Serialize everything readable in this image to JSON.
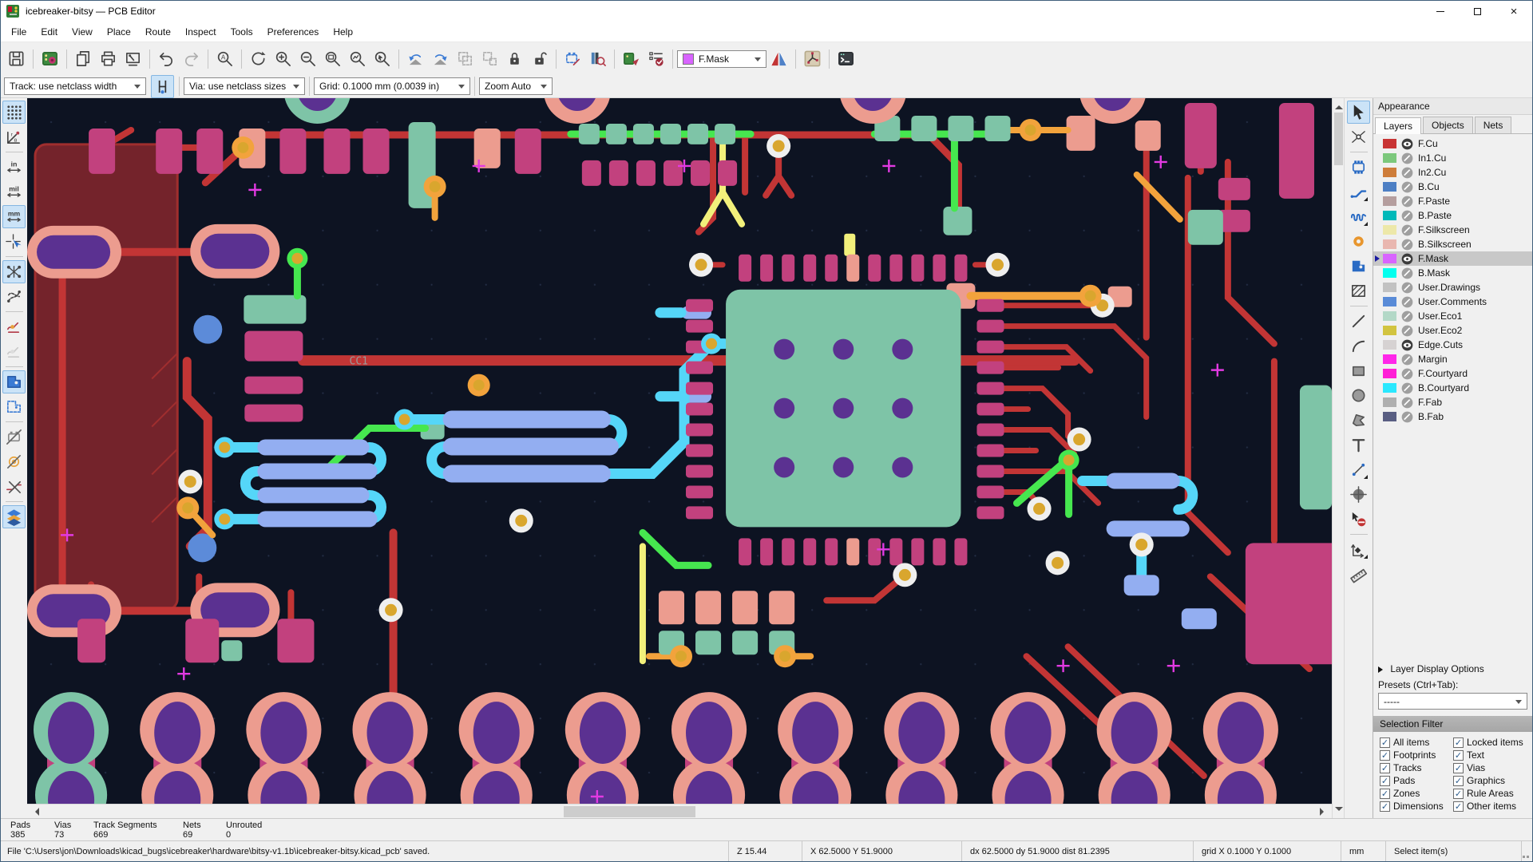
{
  "window": {
    "title": "icebreaker-bitsy — PCB Editor"
  },
  "menu": {
    "items": [
      "File",
      "Edit",
      "View",
      "Place",
      "Route",
      "Inspect",
      "Tools",
      "Preferences",
      "Help"
    ]
  },
  "toolbar": {
    "layer_select": "F.Mask",
    "layer_swatch": "#D864FF",
    "track_select": "Track: use netclass width",
    "via_select": "Via: use netclass sizes",
    "grid_select": "Grid: 0.1000 mm (0.0039 in)",
    "zoom_select": "Zoom Auto"
  },
  "appearance": {
    "title": "Appearance",
    "tabs": [
      "Layers",
      "Objects",
      "Nets"
    ],
    "active_tab": "Layers",
    "layers": [
      {
        "name": "F.Cu",
        "color": "#C83434",
        "visible": true,
        "selected": false
      },
      {
        "name": "In1.Cu",
        "color": "#7CC87C",
        "visible": false,
        "selected": false
      },
      {
        "name": "In2.Cu",
        "color": "#CE7D3A",
        "visible": false,
        "selected": false
      },
      {
        "name": "B.Cu",
        "color": "#4D7FC4",
        "visible": false,
        "selected": false
      },
      {
        "name": "F.Paste",
        "color": "#B59E9E",
        "visible": false,
        "selected": false
      },
      {
        "name": "B.Paste",
        "color": "#00B9B9",
        "visible": false,
        "selected": false
      },
      {
        "name": "F.Silkscreen",
        "color": "#EDE8A9",
        "visible": false,
        "selected": false
      },
      {
        "name": "B.Silkscreen",
        "color": "#E9B7B0",
        "visible": false,
        "selected": false
      },
      {
        "name": "F.Mask",
        "color": "#D864FF",
        "visible": true,
        "selected": true
      },
      {
        "name": "B.Mask",
        "color": "#02FFEE",
        "visible": false,
        "selected": false
      },
      {
        "name": "User.Drawings",
        "color": "#C2C2C2",
        "visible": false,
        "selected": false
      },
      {
        "name": "User.Comments",
        "color": "#598BD7",
        "visible": false,
        "selected": false
      },
      {
        "name": "User.Eco1",
        "color": "#B3D8C7",
        "visible": false,
        "selected": false
      },
      {
        "name": "User.Eco2",
        "color": "#D2C440",
        "visible": false,
        "selected": false
      },
      {
        "name": "Edge.Cuts",
        "color": "#D6D2D2",
        "visible": true,
        "selected": false
      },
      {
        "name": "Margin",
        "color": "#FF27E9",
        "visible": false,
        "selected": false
      },
      {
        "name": "F.Courtyard",
        "color": "#FF1FD6",
        "visible": false,
        "selected": false
      },
      {
        "name": "B.Courtyard",
        "color": "#2BE8FE",
        "visible": false,
        "selected": false
      },
      {
        "name": "F.Fab",
        "color": "#AFAFAF",
        "visible": false,
        "selected": false
      },
      {
        "name": "B.Fab",
        "color": "#595E82",
        "visible": false,
        "selected": false
      }
    ],
    "layer_display_options": "Layer Display Options",
    "presets_label": "Presets (Ctrl+Tab):",
    "presets_value": "-----"
  },
  "selection_filter": {
    "title": "Selection Filter",
    "items": [
      {
        "label": "All items",
        "checked": true
      },
      {
        "label": "Locked items",
        "checked": true
      },
      {
        "label": "Footprints",
        "checked": true
      },
      {
        "label": "Text",
        "checked": true
      },
      {
        "label": "Tracks",
        "checked": true
      },
      {
        "label": "Vias",
        "checked": true
      },
      {
        "label": "Pads",
        "checked": true
      },
      {
        "label": "Graphics",
        "checked": true
      },
      {
        "label": "Zones",
        "checked": true
      },
      {
        "label": "Rule Areas",
        "checked": true
      },
      {
        "label": "Dimensions",
        "checked": true
      },
      {
        "label": "Other items",
        "checked": true
      }
    ]
  },
  "status": {
    "counters": [
      {
        "label": "Pads",
        "value": "385"
      },
      {
        "label": "Vias",
        "value": "73"
      },
      {
        "label": "Track Segments",
        "value": "669"
      },
      {
        "label": "Nets",
        "value": "69"
      },
      {
        "label": "Unrouted",
        "value": "0"
      }
    ],
    "message": "File 'C:\\Users\\jon\\Downloads\\kicad_bugs\\icebreaker\\hardware\\bitsy-v1.1b\\icebreaker-bitsy.kicad_pcb' saved.",
    "zoom": "Z 15.44",
    "position": "X 62.5000  Y 51.9000",
    "delta": "dx 62.5000  dy 51.9000  dist 81.2395",
    "grid": "grid X 0.1000  Y 0.1000",
    "units": "mm",
    "action": "Select item(s)"
  },
  "canvas": {
    "labels": {
      "cc1": "CC1"
    },
    "colors": {
      "bg": "#0D1322",
      "zone": "#74232B",
      "zone_edge": "#A02E2E",
      "red": "#C23535",
      "magenta": "#C2417E",
      "salmon": "#EC9C8F",
      "seagreen": "#7EC4A7",
      "green": "#46E74F",
      "yellow": "#F2F07B",
      "orange": "#F2A33C",
      "mustard": "#D9A62E",
      "white": "#EFEFEF",
      "purple": "#5B3191",
      "periwinkle": "#93AEF1",
      "cyan": "#55D6F8",
      "blue": "#5C8BD9",
      "cross": "#E23AE2",
      "label": "#9A9A9A",
      "grid_dot": "#232D45"
    }
  }
}
